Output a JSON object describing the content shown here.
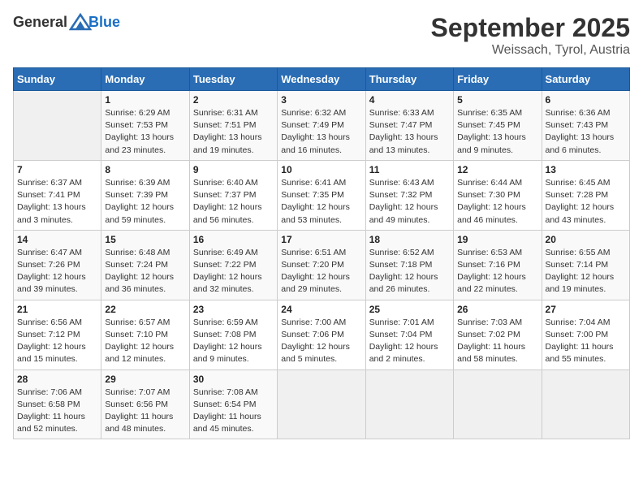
{
  "header": {
    "logo_general": "General",
    "logo_blue": "Blue",
    "month": "September 2025",
    "location": "Weissach, Tyrol, Austria"
  },
  "days_of_week": [
    "Sunday",
    "Monday",
    "Tuesday",
    "Wednesday",
    "Thursday",
    "Friday",
    "Saturday"
  ],
  "weeks": [
    [
      {
        "day": "",
        "info": ""
      },
      {
        "day": "1",
        "info": "Sunrise: 6:29 AM\nSunset: 7:53 PM\nDaylight: 13 hours\nand 23 minutes."
      },
      {
        "day": "2",
        "info": "Sunrise: 6:31 AM\nSunset: 7:51 PM\nDaylight: 13 hours\nand 19 minutes."
      },
      {
        "day": "3",
        "info": "Sunrise: 6:32 AM\nSunset: 7:49 PM\nDaylight: 13 hours\nand 16 minutes."
      },
      {
        "day": "4",
        "info": "Sunrise: 6:33 AM\nSunset: 7:47 PM\nDaylight: 13 hours\nand 13 minutes."
      },
      {
        "day": "5",
        "info": "Sunrise: 6:35 AM\nSunset: 7:45 PM\nDaylight: 13 hours\nand 9 minutes."
      },
      {
        "day": "6",
        "info": "Sunrise: 6:36 AM\nSunset: 7:43 PM\nDaylight: 13 hours\nand 6 minutes."
      }
    ],
    [
      {
        "day": "7",
        "info": "Sunrise: 6:37 AM\nSunset: 7:41 PM\nDaylight: 13 hours\nand 3 minutes."
      },
      {
        "day": "8",
        "info": "Sunrise: 6:39 AM\nSunset: 7:39 PM\nDaylight: 12 hours\nand 59 minutes."
      },
      {
        "day": "9",
        "info": "Sunrise: 6:40 AM\nSunset: 7:37 PM\nDaylight: 12 hours\nand 56 minutes."
      },
      {
        "day": "10",
        "info": "Sunrise: 6:41 AM\nSunset: 7:35 PM\nDaylight: 12 hours\nand 53 minutes."
      },
      {
        "day": "11",
        "info": "Sunrise: 6:43 AM\nSunset: 7:32 PM\nDaylight: 12 hours\nand 49 minutes."
      },
      {
        "day": "12",
        "info": "Sunrise: 6:44 AM\nSunset: 7:30 PM\nDaylight: 12 hours\nand 46 minutes."
      },
      {
        "day": "13",
        "info": "Sunrise: 6:45 AM\nSunset: 7:28 PM\nDaylight: 12 hours\nand 43 minutes."
      }
    ],
    [
      {
        "day": "14",
        "info": "Sunrise: 6:47 AM\nSunset: 7:26 PM\nDaylight: 12 hours\nand 39 minutes."
      },
      {
        "day": "15",
        "info": "Sunrise: 6:48 AM\nSunset: 7:24 PM\nDaylight: 12 hours\nand 36 minutes."
      },
      {
        "day": "16",
        "info": "Sunrise: 6:49 AM\nSunset: 7:22 PM\nDaylight: 12 hours\nand 32 minutes."
      },
      {
        "day": "17",
        "info": "Sunrise: 6:51 AM\nSunset: 7:20 PM\nDaylight: 12 hours\nand 29 minutes."
      },
      {
        "day": "18",
        "info": "Sunrise: 6:52 AM\nSunset: 7:18 PM\nDaylight: 12 hours\nand 26 minutes."
      },
      {
        "day": "19",
        "info": "Sunrise: 6:53 AM\nSunset: 7:16 PM\nDaylight: 12 hours\nand 22 minutes."
      },
      {
        "day": "20",
        "info": "Sunrise: 6:55 AM\nSunset: 7:14 PM\nDaylight: 12 hours\nand 19 minutes."
      }
    ],
    [
      {
        "day": "21",
        "info": "Sunrise: 6:56 AM\nSunset: 7:12 PM\nDaylight: 12 hours\nand 15 minutes."
      },
      {
        "day": "22",
        "info": "Sunrise: 6:57 AM\nSunset: 7:10 PM\nDaylight: 12 hours\nand 12 minutes."
      },
      {
        "day": "23",
        "info": "Sunrise: 6:59 AM\nSunset: 7:08 PM\nDaylight: 12 hours\nand 9 minutes."
      },
      {
        "day": "24",
        "info": "Sunrise: 7:00 AM\nSunset: 7:06 PM\nDaylight: 12 hours\nand 5 minutes."
      },
      {
        "day": "25",
        "info": "Sunrise: 7:01 AM\nSunset: 7:04 PM\nDaylight: 12 hours\nand 2 minutes."
      },
      {
        "day": "26",
        "info": "Sunrise: 7:03 AM\nSunset: 7:02 PM\nDaylight: 11 hours\nand 58 minutes."
      },
      {
        "day": "27",
        "info": "Sunrise: 7:04 AM\nSunset: 7:00 PM\nDaylight: 11 hours\nand 55 minutes."
      }
    ],
    [
      {
        "day": "28",
        "info": "Sunrise: 7:06 AM\nSunset: 6:58 PM\nDaylight: 11 hours\nand 52 minutes."
      },
      {
        "day": "29",
        "info": "Sunrise: 7:07 AM\nSunset: 6:56 PM\nDaylight: 11 hours\nand 48 minutes."
      },
      {
        "day": "30",
        "info": "Sunrise: 7:08 AM\nSunset: 6:54 PM\nDaylight: 11 hours\nand 45 minutes."
      },
      {
        "day": "",
        "info": ""
      },
      {
        "day": "",
        "info": ""
      },
      {
        "day": "",
        "info": ""
      },
      {
        "day": "",
        "info": ""
      }
    ]
  ]
}
